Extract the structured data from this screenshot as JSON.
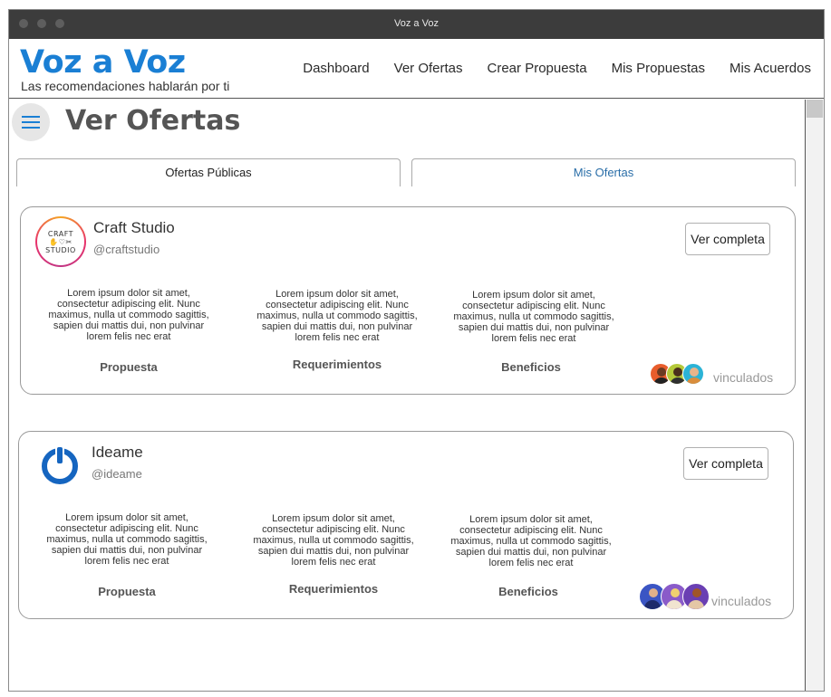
{
  "window": {
    "title": "Voz a Voz"
  },
  "header": {
    "brand": "Voz a Voz",
    "tagline": "Las recomendaciones hablarán por ti",
    "nav": [
      "Dashboard",
      "Ver Ofertas",
      "Crear Propuesta",
      "Mis Propuestas",
      "Mis Acuerdos"
    ]
  },
  "page": {
    "title": "Ver Ofertas",
    "tabs": [
      {
        "label": "Ofertas Públicas",
        "selected": true
      },
      {
        "label": "Mis Ofertas",
        "selected": false
      }
    ]
  },
  "offers": [
    {
      "name": "Craft Studio",
      "handle": "@craftstudio",
      "logo_text": [
        "CRAFT",
        "✋♡✂",
        "STUDIO"
      ],
      "button": "Ver completa",
      "columns": [
        {
          "text": "Lorem ipsum dolor sit amet, consectetur adipiscing elit. Nunc maximus, nulla ut commodo sagittis, sapien dui mattis dui, non pulvinar lorem felis nec erat",
          "label": "Propuesta"
        },
        {
          "text": "Lorem ipsum dolor sit amet, consectetur adipiscing elit. Nunc maximus, nulla ut commodo sagittis, sapien dui mattis dui, non pulvinar lorem felis nec erat",
          "label": "Requerimientos"
        },
        {
          "text": "Lorem ipsum dolor sit amet, consectetur adipiscing elit. Nunc maximus, nulla ut commodo sagittis, sapien dui mattis dui, non pulvinar lorem felis nec erat",
          "label": "Beneficios"
        }
      ],
      "linked_label": "vinculados"
    },
    {
      "name": "Ideame",
      "handle": "@ideame",
      "button": "Ver completa",
      "columns": [
        {
          "text": "Lorem ipsum dolor sit amet, consectetur adipiscing elit. Nunc maximus, nulla ut commodo sagittis, sapien dui mattis dui, non pulvinar lorem felis nec erat",
          "label": "Propuesta"
        },
        {
          "text": "Lorem ipsum dolor sit amet, consectetur adipiscing elit. Nunc maximus, nulla ut commodo sagittis, sapien dui mattis dui, non pulvinar lorem felis nec erat",
          "label": "Requerimientos"
        },
        {
          "text": "Lorem ipsum dolor sit amet, consectetur adipiscing elit. Nunc maximus, nulla ut commodo sagittis, sapien dui mattis dui, non pulvinar lorem felis nec erat",
          "label": "Beneficios"
        }
      ],
      "linked_label": "vinculados"
    }
  ],
  "colors": {
    "brand": "#1a7fd4",
    "tab_link": "#2a6ea8",
    "ideame_logo": "#1565c0"
  },
  "icons": {
    "menu": "hamburger-icon",
    "ideame_logo": "power-icon"
  }
}
